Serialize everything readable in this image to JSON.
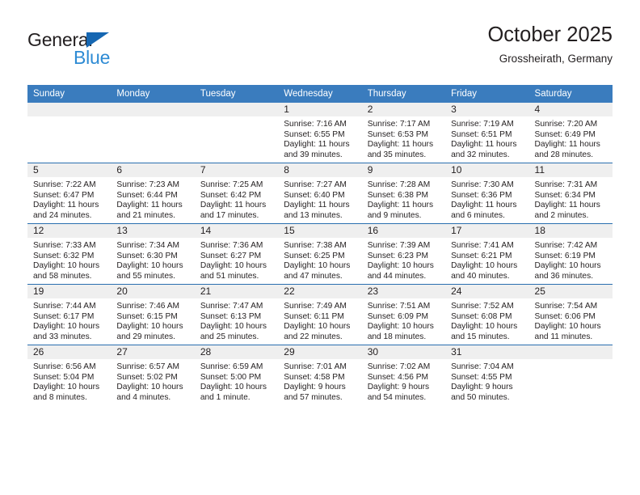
{
  "brand": {
    "name_part1": "General",
    "name_part2": "Blue",
    "triangle_color": "#1667b2",
    "blue_text_color": "#2e8bd4"
  },
  "header": {
    "title": "October 2025",
    "subtitle": "Grossheirath, Germany"
  },
  "theme": {
    "header_bar": "#3a7cbe",
    "row_divider": "#2a6fb0",
    "day_band": "#efefef",
    "text": "#231f20"
  },
  "weekdays": [
    "Sunday",
    "Monday",
    "Tuesday",
    "Wednesday",
    "Thursday",
    "Friday",
    "Saturday"
  ],
  "labels": {
    "sunrise_prefix": "Sunrise:",
    "sunset_prefix": "Sunset:",
    "daylight_prefix": "Daylight:"
  },
  "weeks": [
    [
      {
        "day": "",
        "blank": true
      },
      {
        "day": "",
        "blank": true
      },
      {
        "day": "",
        "blank": true
      },
      {
        "day": "1",
        "sunrise": "Sunrise: 7:16 AM",
        "sunset": "Sunset: 6:55 PM",
        "daylight_line1": "Daylight: 11 hours",
        "daylight_line2": "and 39 minutes."
      },
      {
        "day": "2",
        "sunrise": "Sunrise: 7:17 AM",
        "sunset": "Sunset: 6:53 PM",
        "daylight_line1": "Daylight: 11 hours",
        "daylight_line2": "and 35 minutes."
      },
      {
        "day": "3",
        "sunrise": "Sunrise: 7:19 AM",
        "sunset": "Sunset: 6:51 PM",
        "daylight_line1": "Daylight: 11 hours",
        "daylight_line2": "and 32 minutes."
      },
      {
        "day": "4",
        "sunrise": "Sunrise: 7:20 AM",
        "sunset": "Sunset: 6:49 PM",
        "daylight_line1": "Daylight: 11 hours",
        "daylight_line2": "and 28 minutes."
      }
    ],
    [
      {
        "day": "5",
        "sunrise": "Sunrise: 7:22 AM",
        "sunset": "Sunset: 6:47 PM",
        "daylight_line1": "Daylight: 11 hours",
        "daylight_line2": "and 24 minutes."
      },
      {
        "day": "6",
        "sunrise": "Sunrise: 7:23 AM",
        "sunset": "Sunset: 6:44 PM",
        "daylight_line1": "Daylight: 11 hours",
        "daylight_line2": "and 21 minutes."
      },
      {
        "day": "7",
        "sunrise": "Sunrise: 7:25 AM",
        "sunset": "Sunset: 6:42 PM",
        "daylight_line1": "Daylight: 11 hours",
        "daylight_line2": "and 17 minutes."
      },
      {
        "day": "8",
        "sunrise": "Sunrise: 7:27 AM",
        "sunset": "Sunset: 6:40 PM",
        "daylight_line1": "Daylight: 11 hours",
        "daylight_line2": "and 13 minutes."
      },
      {
        "day": "9",
        "sunrise": "Sunrise: 7:28 AM",
        "sunset": "Sunset: 6:38 PM",
        "daylight_line1": "Daylight: 11 hours",
        "daylight_line2": "and 9 minutes."
      },
      {
        "day": "10",
        "sunrise": "Sunrise: 7:30 AM",
        "sunset": "Sunset: 6:36 PM",
        "daylight_line1": "Daylight: 11 hours",
        "daylight_line2": "and 6 minutes."
      },
      {
        "day": "11",
        "sunrise": "Sunrise: 7:31 AM",
        "sunset": "Sunset: 6:34 PM",
        "daylight_line1": "Daylight: 11 hours",
        "daylight_line2": "and 2 minutes."
      }
    ],
    [
      {
        "day": "12",
        "sunrise": "Sunrise: 7:33 AM",
        "sunset": "Sunset: 6:32 PM",
        "daylight_line1": "Daylight: 10 hours",
        "daylight_line2": "and 58 minutes."
      },
      {
        "day": "13",
        "sunrise": "Sunrise: 7:34 AM",
        "sunset": "Sunset: 6:30 PM",
        "daylight_line1": "Daylight: 10 hours",
        "daylight_line2": "and 55 minutes."
      },
      {
        "day": "14",
        "sunrise": "Sunrise: 7:36 AM",
        "sunset": "Sunset: 6:27 PM",
        "daylight_line1": "Daylight: 10 hours",
        "daylight_line2": "and 51 minutes."
      },
      {
        "day": "15",
        "sunrise": "Sunrise: 7:38 AM",
        "sunset": "Sunset: 6:25 PM",
        "daylight_line1": "Daylight: 10 hours",
        "daylight_line2": "and 47 minutes."
      },
      {
        "day": "16",
        "sunrise": "Sunrise: 7:39 AM",
        "sunset": "Sunset: 6:23 PM",
        "daylight_line1": "Daylight: 10 hours",
        "daylight_line2": "and 44 minutes."
      },
      {
        "day": "17",
        "sunrise": "Sunrise: 7:41 AM",
        "sunset": "Sunset: 6:21 PM",
        "daylight_line1": "Daylight: 10 hours",
        "daylight_line2": "and 40 minutes."
      },
      {
        "day": "18",
        "sunrise": "Sunrise: 7:42 AM",
        "sunset": "Sunset: 6:19 PM",
        "daylight_line1": "Daylight: 10 hours",
        "daylight_line2": "and 36 minutes."
      }
    ],
    [
      {
        "day": "19",
        "sunrise": "Sunrise: 7:44 AM",
        "sunset": "Sunset: 6:17 PM",
        "daylight_line1": "Daylight: 10 hours",
        "daylight_line2": "and 33 minutes."
      },
      {
        "day": "20",
        "sunrise": "Sunrise: 7:46 AM",
        "sunset": "Sunset: 6:15 PM",
        "daylight_line1": "Daylight: 10 hours",
        "daylight_line2": "and 29 minutes."
      },
      {
        "day": "21",
        "sunrise": "Sunrise: 7:47 AM",
        "sunset": "Sunset: 6:13 PM",
        "daylight_line1": "Daylight: 10 hours",
        "daylight_line2": "and 25 minutes."
      },
      {
        "day": "22",
        "sunrise": "Sunrise: 7:49 AM",
        "sunset": "Sunset: 6:11 PM",
        "daylight_line1": "Daylight: 10 hours",
        "daylight_line2": "and 22 minutes."
      },
      {
        "day": "23",
        "sunrise": "Sunrise: 7:51 AM",
        "sunset": "Sunset: 6:09 PM",
        "daylight_line1": "Daylight: 10 hours",
        "daylight_line2": "and 18 minutes."
      },
      {
        "day": "24",
        "sunrise": "Sunrise: 7:52 AM",
        "sunset": "Sunset: 6:08 PM",
        "daylight_line1": "Daylight: 10 hours",
        "daylight_line2": "and 15 minutes."
      },
      {
        "day": "25",
        "sunrise": "Sunrise: 7:54 AM",
        "sunset": "Sunset: 6:06 PM",
        "daylight_line1": "Daylight: 10 hours",
        "daylight_line2": "and 11 minutes."
      }
    ],
    [
      {
        "day": "26",
        "sunrise": "Sunrise: 6:56 AM",
        "sunset": "Sunset: 5:04 PM",
        "daylight_line1": "Daylight: 10 hours",
        "daylight_line2": "and 8 minutes."
      },
      {
        "day": "27",
        "sunrise": "Sunrise: 6:57 AM",
        "sunset": "Sunset: 5:02 PM",
        "daylight_line1": "Daylight: 10 hours",
        "daylight_line2": "and 4 minutes."
      },
      {
        "day": "28",
        "sunrise": "Sunrise: 6:59 AM",
        "sunset": "Sunset: 5:00 PM",
        "daylight_line1": "Daylight: 10 hours",
        "daylight_line2": "and 1 minute."
      },
      {
        "day": "29",
        "sunrise": "Sunrise: 7:01 AM",
        "sunset": "Sunset: 4:58 PM",
        "daylight_line1": "Daylight: 9 hours",
        "daylight_line2": "and 57 minutes."
      },
      {
        "day": "30",
        "sunrise": "Sunrise: 7:02 AM",
        "sunset": "Sunset: 4:56 PM",
        "daylight_line1": "Daylight: 9 hours",
        "daylight_line2": "and 54 minutes."
      },
      {
        "day": "31",
        "sunrise": "Sunrise: 7:04 AM",
        "sunset": "Sunset: 4:55 PM",
        "daylight_line1": "Daylight: 9 hours",
        "daylight_line2": "and 50 minutes."
      },
      {
        "day": "",
        "blank": true
      }
    ]
  ]
}
